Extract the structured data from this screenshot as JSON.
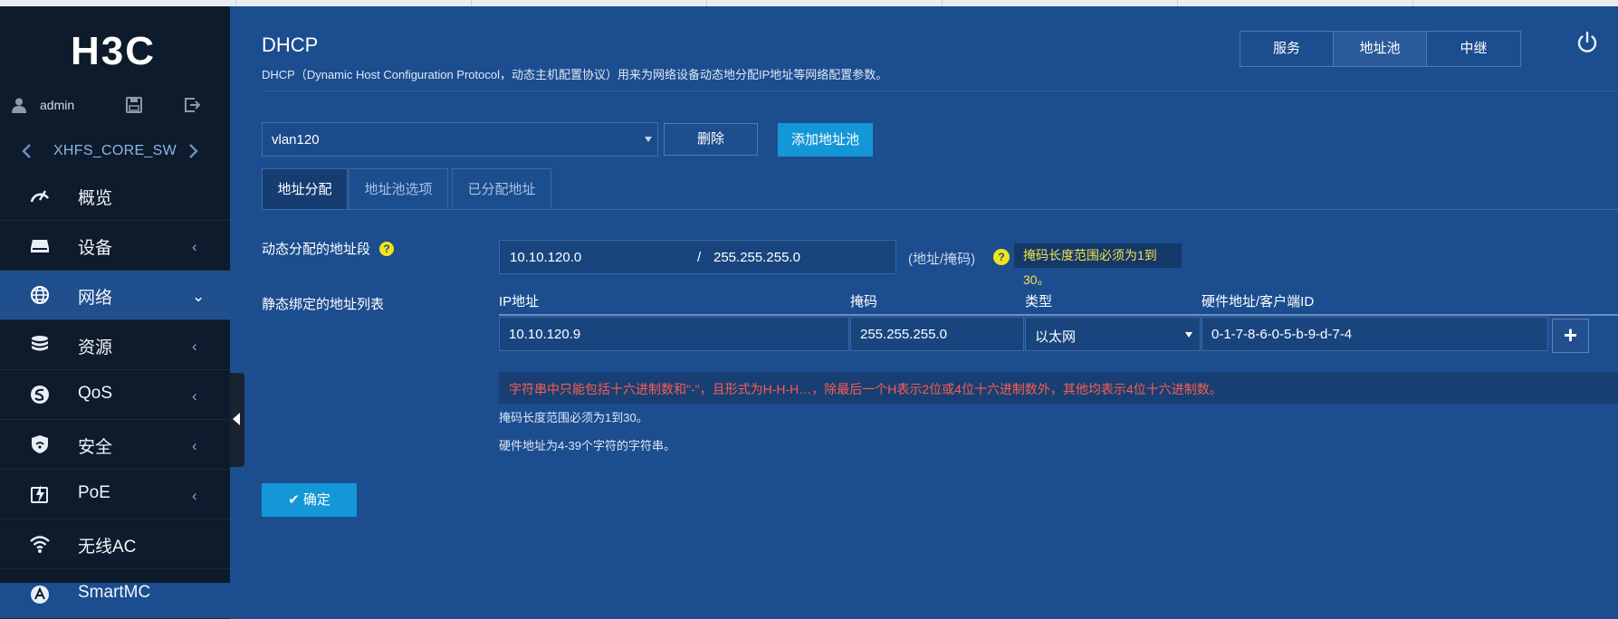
{
  "brand": {
    "logo_text": "H3C"
  },
  "user": {
    "name": "admin"
  },
  "device": {
    "name": "XHFS_CORE_SW"
  },
  "menu": [
    {
      "label": "概览",
      "icon": "gauge-icon",
      "arrow": ""
    },
    {
      "label": "设备",
      "icon": "device-icon",
      "arrow": "‹"
    },
    {
      "label": "网络",
      "icon": "globe-icon",
      "arrow": "⌄"
    },
    {
      "label": "资源",
      "icon": "database-icon",
      "arrow": "‹"
    },
    {
      "label": "QoS",
      "icon": "qos-icon",
      "arrow": "‹"
    },
    {
      "label": "安全",
      "icon": "shield-icon",
      "arrow": "‹"
    },
    {
      "label": "PoE",
      "icon": "poe-icon",
      "arrow": "‹"
    },
    {
      "label": "无线AC",
      "icon": "wifi-icon",
      "arrow": ""
    },
    {
      "label": "SmartMC",
      "icon": "smartmc-icon",
      "arrow": ""
    }
  ],
  "page": {
    "title": "DHCP",
    "description": "DHCP（Dynamic Host Configuration Protocol，动态主机配置协议）用来为网络设备动态地分配IP地址等网络配置参数。"
  },
  "topnav": {
    "tabs": [
      "服务",
      "地址池",
      "中继"
    ],
    "active": "地址池"
  },
  "pool": {
    "selected": "vlan120",
    "delete_label": "删除",
    "add_label": "添加地址池"
  },
  "tabs": [
    "地址分配",
    "地址池选项",
    "已分配地址"
  ],
  "dynamic": {
    "label": "动态分配的地址段",
    "address": "10.10.120.0",
    "separator": "/",
    "mask": "255.255.255.0",
    "format_hint": "(地址/掩码)",
    "warning": "掩码长度范围必须为1到30。"
  },
  "static": {
    "label": "静态绑定的地址列表",
    "columns": [
      "IP地址",
      "掩码",
      "类型",
      "硬件地址/客户端ID"
    ],
    "row": {
      "ip": "10.10.120.9",
      "mask": "255.255.255.0",
      "type": "以太网",
      "hw": "0-1-7-8-6-0-5-b-9-d-7-4"
    },
    "add_symbol": "+"
  },
  "messages": {
    "error": "字符串中只能包括十六进制数和\"-\"，且形式为H-H-H…，除最后一个H表示2位或4位十六进制数外，其他均表示4位十六进制数。",
    "note1": "掩码长度范围必须为1到30。",
    "note2": "硬件地址为4-39个字符的字符串。"
  },
  "ok_label": "确定",
  "colors": {
    "background": "#1c4d8f",
    "sidebar": "#0d1b2c",
    "accent": "#1497d7",
    "error": "#ff5b4f",
    "warning": "#f4e04a"
  }
}
